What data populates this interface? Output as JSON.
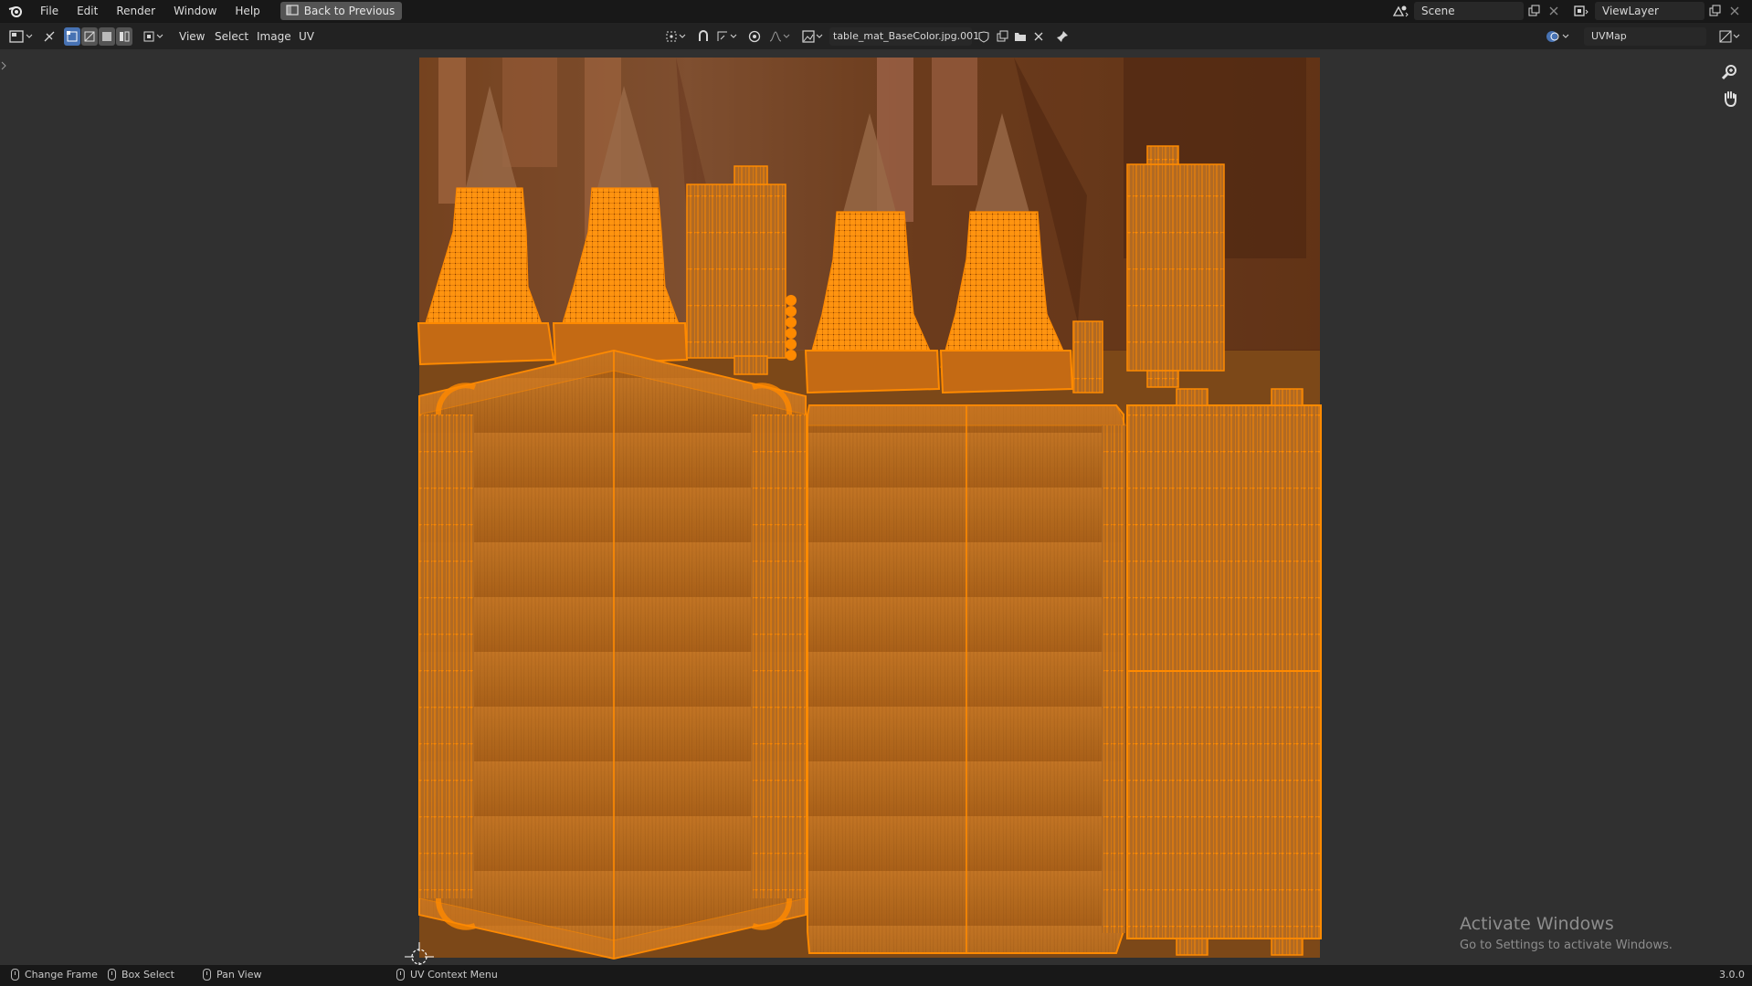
{
  "topbar": {
    "menus": [
      "File",
      "Edit",
      "Render",
      "Window",
      "Help"
    ],
    "back_button": "Back to Previous",
    "scene": "Scene",
    "view_layer": "ViewLayer"
  },
  "editor_header": {
    "menus": [
      "View",
      "Select",
      "Image",
      "UV"
    ],
    "image_name": "table_mat_BaseColor.jpg.001",
    "uv_map": "UVMap"
  },
  "statusbar": {
    "change_frame": "Change Frame",
    "box_select": "Box Select",
    "pan_view": "Pan View",
    "uv_context_menu": "UV Context Menu",
    "version": "3.0.0"
  },
  "watermark": {
    "title": "Activate Windows",
    "subtitle": "Go to Settings to activate Windows."
  },
  "colors": {
    "uv_selected": "#ff8a00",
    "texture_wood": "#b86a20",
    "background": "#303030",
    "header": "#222222",
    "topbar": "#181818"
  },
  "icons": [
    "blender-logo",
    "back-icon",
    "scene-icon",
    "viewlayer-icon",
    "editor-type-icon",
    "sync-selection-icon",
    "pivot-icon",
    "snap-icon",
    "proportional-icon",
    "image-browse-icon",
    "fake-user-icon",
    "new-image-icon",
    "open-image-icon",
    "unlink-icon",
    "pin-icon",
    "overlay-icon",
    "display-channels-icon",
    "zoom-icon",
    "hand-icon"
  ]
}
